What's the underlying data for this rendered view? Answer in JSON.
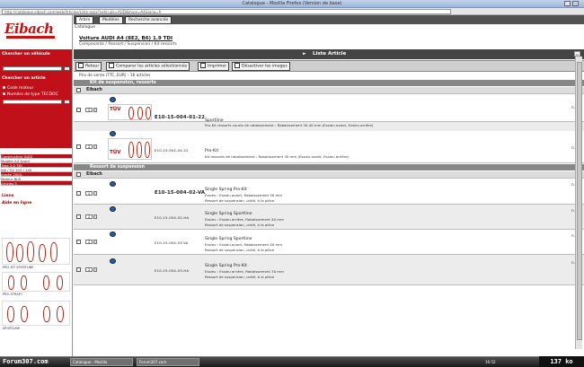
{
  "window": {
    "title": "Catalogue - Mozilla Firefox (Version de base)"
  },
  "address": {
    "url": "http://catalogue.eibach.com/web/Articles/Liste.aspx?vehicule=AUDI&type=A4&lang=fr"
  },
  "sidebar": {
    "logo": "Eibach",
    "red_panel": {
      "heading1": "Chercher un véhicule",
      "heading2": "Chercher un article",
      "option1": "Code moteur",
      "option2": "Numéro de type TECDOC"
    },
    "info_rows": [
      {
        "label": "Constructeur",
        "value": "AUDI"
      },
      {
        "label": "Modèle",
        "value": "A4 Avant"
      },
      {
        "label": "Type",
        "value": "2.0 TDI"
      },
      {
        "label": "kW / CV",
        "value": "103 / 140"
      },
      {
        "label": "Année",
        "value": "2004-"
      },
      {
        "label": "Moteur",
        "value": "BLB"
      },
      {
        "label": "Articles",
        "value": "5"
      }
    ],
    "links": [
      "Liens",
      "Aide en ligne"
    ],
    "thumbs": [
      "PRO-KIT SPORTLINE",
      "PRO-STREET",
      "SPORTLINE"
    ]
  },
  "main": {
    "tabs": [
      {
        "label": "Arbre"
      },
      {
        "label": "Modèles"
      },
      {
        "label": "Recherche avancée"
      }
    ],
    "catalog_label": "Catalogue",
    "breadcrumb": "Voiture AUDI A4 (8E2, B6) 1.9 TDI",
    "subtitle": "Composants / Ressort / Suspension / Kit ressorts",
    "list_title": "Liste Article",
    "actions": [
      {
        "label": "Retour"
      },
      {
        "label": "Comparer les articles sélectionnés"
      },
      {
        "label": "Imprimer"
      },
      {
        "label": "Désactiver les images"
      }
    ],
    "price_note": "Prix de vente (TTC, EUR) - 16 articles",
    "groups": [
      {
        "name": "Kit de suspension, ressorts",
        "brand": "Eibach",
        "articles": [
          {
            "qty": "1",
            "ref": "E10-15-004-01-22",
            "title": "Sportline",
            "lines": [
              "Pro-Kit ressorts courts de rabaissement : Rabaissement 30-40 mm (Essieu avant, Essieu arrière)"
            ],
            "avail": "n.d."
          },
          {
            "qty": "1",
            "ref": "E10-15-004-04-22",
            "title": "Pro-Kit",
            "lines": [
              "Kit ressorts de rabaissement : Rabaissement 30 mm (Essieu avant, Essieu arrière)"
            ],
            "avail": "n.d."
          }
        ]
      },
      {
        "name": "Ressort de suspension",
        "brand": "Eibach",
        "articles": [
          {
            "qty": "1",
            "ref": "E10-15-004-02-VA",
            "title": "Single Spring Pro-Kit",
            "lines": [
              "Essieu : Essieu avant, Rabaissement 30 mm",
              "Ressort de suspension, unité, à la pièce"
            ],
            "avail": "n.d."
          },
          {
            "qty": "1",
            "ref": "E10-15-004-02-HA",
            "title": "Single Spring Sportline",
            "lines": [
              "Essieu : Essieu arrière, Rabaissement 40 mm",
              "Ressort de suspension, unité, à la pièce"
            ],
            "avail": "n.d."
          },
          {
            "qty": "1",
            "ref": "E10-15-004-03-VA",
            "title": "Single Spring Sportline",
            "lines": [
              "Essieu : Essieu avant, Rabaissement 40 mm",
              "Ressort de suspension, unité, à la pièce"
            ],
            "avail": "n.d."
          },
          {
            "qty": "1",
            "ref": "E10-15-004-03-HA",
            "title": "Single Spring Pro-Kit",
            "lines": [
              "Essieu : Essieu arrière, Rabaissement 30 mm",
              "Ressort de suspension, unité, à la pièce"
            ],
            "avail": "n.d."
          }
        ]
      }
    ]
  },
  "taskbar": {
    "watermark": "Forum307.com",
    "tasks": [
      "Catalogue - Mozilla",
      "Forum307.com"
    ],
    "tray": "16:52"
  },
  "image_size_badge": "137 ko"
}
